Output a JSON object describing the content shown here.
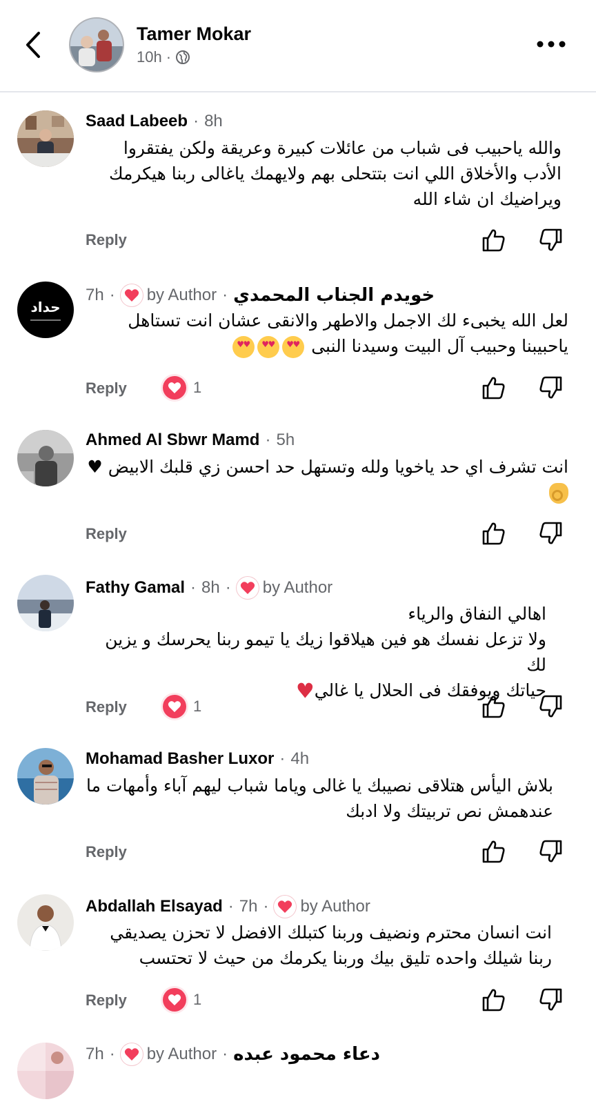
{
  "header": {
    "name": "Tamer Mokar",
    "time": "10h",
    "separator": "·",
    "privacy_icon": "globe-icon"
  },
  "ui": {
    "reply_label": "Reply",
    "by_author_label": "by Author",
    "dot": "·"
  },
  "comments": [
    {
      "name": "Saad Labeeb",
      "time": "8h",
      "by_author": false,
      "text": "والله ياحبيب فى شباب من عائلات كبيرة وعريقة ولكن يفتقروا الأدب والأخلاق اللي انت بتتحلى بهم ولايهمك ياغالى ربنا هيكرمك ويراضيك ان شاء الله",
      "reactions": null
    },
    {
      "name": "خويدم الجناب المحمدي",
      "time": "7h",
      "by_author": true,
      "avatar_text": "حداد",
      "text": "لعل الله يخبىء لك الاجمل والاطهر والانقى عشان انت تستاهل ياحبيبنا وحبيب آل البيت وسيدنا النبى",
      "emoji": "heart-eyes-emoji",
      "reactions": "1"
    },
    {
      "name": "Ahmed Al Sbwr Mamd",
      "time": "5h",
      "by_author": false,
      "text": "انت تشرف اي حد ياخويا ولله وتستهل حد احسن زي قلبك الابيض ♥",
      "emoji": "ok-hand-emoji",
      "reactions": null
    },
    {
      "name": "Fathy Gamal",
      "time": "8h",
      "by_author": true,
      "text_lines": [
        "اهالي النفاق والرياء",
        "ولا تزعل نفسك هو فين هيلاقوا زيك يا تيمو ربنا يحرسك و يزين لك",
        "حياتك ويوفقك فى الحلال يا غالي"
      ],
      "emoji": "red-heart-emoji",
      "reactions": "1"
    },
    {
      "name": "Mohamad Basher Luxor",
      "time": "4h",
      "by_author": false,
      "text": "بلاش اليأس هتلاقى نصيبك يا غالى وياما شباب ليهم آباء وأمهات ما عندهمش نص تربيتك ولا ادبك",
      "reactions": null
    },
    {
      "name": "Abdallah Elsayad",
      "time": "7h",
      "by_author": true,
      "text": "انت انسان محترم ونضيف وربنا كتبلك الافضل لا تحزن يصديقي ربنا شيلك واحده تليق بيك وربنا يكرمك من حيث لا تحتسب",
      "reactions": "1"
    },
    {
      "name": "دعاء محمود عبده",
      "time": "7h",
      "by_author": true,
      "text": "",
      "reactions": null
    }
  ]
}
